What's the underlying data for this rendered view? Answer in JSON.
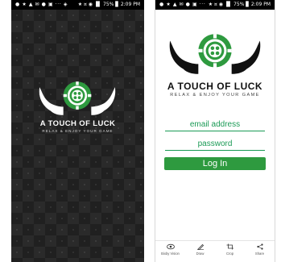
{
  "colors": {
    "brand_green": "#2e9a3f",
    "text_green": "#1a9a55",
    "dark_bg": "#1c1c1c"
  },
  "splash": {
    "status": {
      "icons": "● ★ ▲ ✉ ● ▣ ··· ◈",
      "right": "★ ¤ ◉ ▐▌ 75% ▊ 2:09 PM"
    },
    "title": "A TOUCH OF LUCK",
    "tagline": "RELAX & ENJOY YOUR GAME"
  },
  "login": {
    "status": {
      "icons": "● ★ ▲ ✉ ● ▣ ···",
      "right": "★ ¤ ◉ ▐▌ 75% ▊ 2:09 PM"
    },
    "title": "A TOUCH OF LUCK",
    "tagline": "RELAX & ENJOY YOUR GAME",
    "email_placeholder": "email address",
    "password_placeholder": "password",
    "login_label": "Log In",
    "toolbar": [
      {
        "icon": "eye-icon",
        "label": "Bixby Vision"
      },
      {
        "icon": "draw-icon",
        "label": "Draw"
      },
      {
        "icon": "crop-icon",
        "label": "Crop"
      },
      {
        "icon": "share-icon",
        "label": "Share"
      }
    ]
  }
}
